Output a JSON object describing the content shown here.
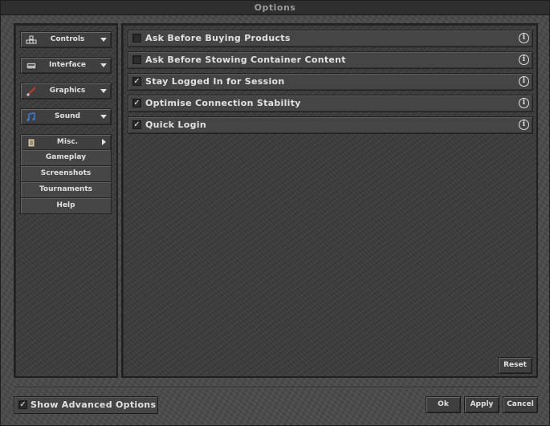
{
  "window": {
    "title": "Options"
  },
  "sidebar": {
    "categories": [
      {
        "label": "Controls",
        "icon": "controls-icon"
      },
      {
        "label": "Interface",
        "icon": "interface-icon"
      },
      {
        "label": "Graphics",
        "icon": "brush-icon"
      },
      {
        "label": "Sound",
        "icon": "music-note-icon"
      },
      {
        "label": "Misc.",
        "icon": "scroll-icon"
      }
    ],
    "misc_items": [
      {
        "label": "Gameplay"
      },
      {
        "label": "Screenshots"
      },
      {
        "label": "Tournaments"
      },
      {
        "label": "Help"
      }
    ]
  },
  "options": [
    {
      "label": "Ask Before Buying Products",
      "checked": false,
      "mark": ""
    },
    {
      "label": "Ask Before Stowing Container Content",
      "checked": false,
      "mark": ""
    },
    {
      "label": "Stay Logged In for Session",
      "checked": true,
      "mark": "✓"
    },
    {
      "label": "Optimise Connection Stability",
      "checked": true,
      "mark": "✓"
    },
    {
      "label": "Quick Login",
      "checked": true,
      "mark": "✓"
    }
  ],
  "info_symbol": "i",
  "buttons": {
    "reset": "Reset",
    "ok": "Ok",
    "apply": "Apply",
    "cancel": "Cancel"
  },
  "advanced": {
    "label": "Show Advanced Options",
    "checked": true,
    "mark": "✓"
  }
}
